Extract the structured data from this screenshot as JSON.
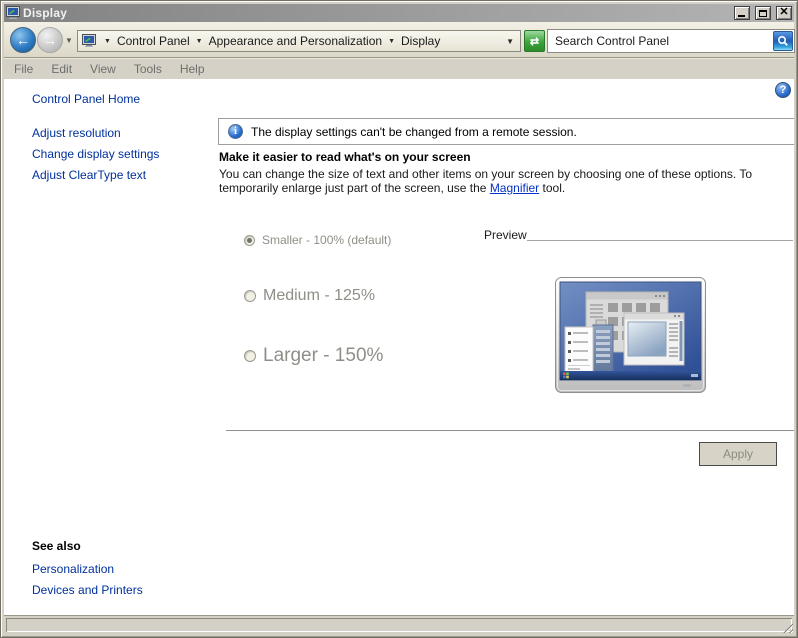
{
  "window": {
    "title": "Display"
  },
  "icons": {
    "breadcrumb_separator": "▼",
    "nav_history_chevron": "▼",
    "breadcrumb_end_chevron": "▼",
    "back_arrow": "←",
    "forward_arrow": "→",
    "refresh": "⇄",
    "info": "i",
    "help": "?"
  },
  "navbar": {
    "breadcrumb": {
      "items": [
        "Control Panel",
        "Appearance and Personalization",
        "Display"
      ]
    },
    "search": {
      "value": "Search Control Panel"
    }
  },
  "menubar": {
    "items": [
      "File",
      "Edit",
      "View",
      "Tools",
      "Help"
    ]
  },
  "sidebar": {
    "home_label": "Control Panel Home",
    "links": [
      "Adjust resolution",
      "Change display settings",
      "Adjust ClearType text"
    ],
    "see_also": {
      "title": "See also",
      "links": [
        "Personalization",
        "Devices and Printers"
      ]
    }
  },
  "main": {
    "info_banner": "The display settings can't be changed from a remote session.",
    "heading": "Make it easier to read what's on your screen",
    "desc_before": "You can change the size of text and other items on your screen by choosing one of these options. To temporarily enlarge just part of the screen, use the ",
    "magnifier_link": "Magnifier",
    "desc_after": " tool.",
    "options": [
      {
        "label": "Smaller - 100% (default)",
        "selected": true
      },
      {
        "label": "Medium - 125%",
        "selected": false
      },
      {
        "label": "Larger - 150%",
        "selected": false
      }
    ],
    "preview_label": "Preview",
    "apply_label": "Apply"
  },
  "colors": {
    "link": "#00309c",
    "titlebar_left": "#828282",
    "titlebar_right": "#b4b4b4",
    "refresh_green": "#3aa53a",
    "search_blue": "#1e5cb8",
    "disabled_text": "#8f8f87"
  }
}
